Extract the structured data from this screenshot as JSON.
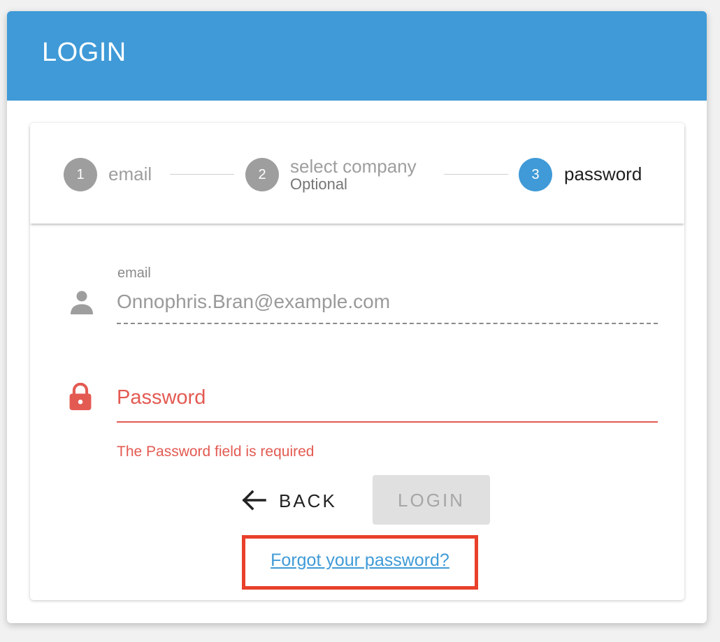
{
  "header": {
    "title": "LOGIN"
  },
  "stepper": {
    "steps": [
      {
        "number": "1",
        "label": "email",
        "state": "complete"
      },
      {
        "number": "2",
        "label": "select company",
        "sublabel": "Optional",
        "state": "complete"
      },
      {
        "number": "3",
        "label": "password",
        "state": "active"
      }
    ]
  },
  "form": {
    "email": {
      "caption": "email",
      "value": "Onnophris.Bran@example.com",
      "icon": "person-icon"
    },
    "password": {
      "placeholder": "Password",
      "error": "The Password field is required",
      "icon": "lock-icon"
    }
  },
  "actions": {
    "back_label": "BACK",
    "login_label": "LOGIN",
    "forgot_label": "Forgot your password?"
  },
  "colors": {
    "brand_blue": "#3f9ad7",
    "error_red": "#e35a52",
    "highlight_box": "#e8402a"
  }
}
